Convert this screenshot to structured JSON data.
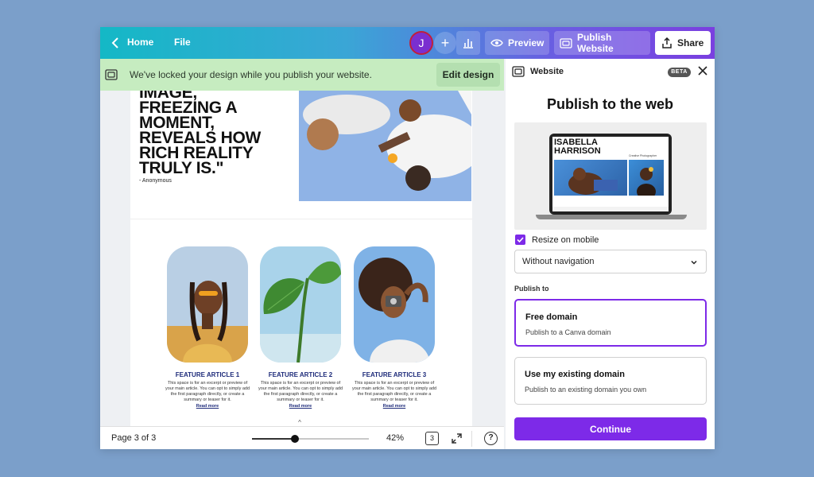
{
  "topbar": {
    "home_label": "Home",
    "file_label": "File",
    "avatar_initial": "J",
    "plus_label": "+",
    "preview_label": "Preview",
    "publish_label": "Publish Website",
    "share_label": "Share"
  },
  "banner": {
    "message": "We've locked your design while you publish your website.",
    "edit_label": "Edit design"
  },
  "canvas": {
    "quote_text": "IMAGE,\nFREEZING A\nMOMENT,\nREVEALS HOW\nRICH REALITY\nTRULY IS.\"",
    "quote_author": "- Anonymous",
    "cards": [
      {
        "title": "FEATURE ARTICLE 1",
        "desc": "This space is for an excerpt or preview of your main article. You can opt to simply add the first paragraph directly, or create a summary or teaser for it.",
        "link": "Read more"
      },
      {
        "title": "FEATURE ARTICLE 2",
        "desc": "This space is for an excerpt or preview of your main article. You can opt to simply add the first paragraph directly, or create a summary or teaser for it.",
        "link": "Read more"
      },
      {
        "title": "FEATURE ARTICLE 3",
        "desc": "This space is for an excerpt or preview of your main article. You can opt to simply add the first paragraph directly, or create a summary or teaser for it.",
        "link": "Read more"
      }
    ],
    "collapse_glyph": "^"
  },
  "bottombar": {
    "page_label": "Page 3 of 3",
    "zoom_level": 0.37,
    "zoom_label": "42%",
    "pages_count": "3",
    "help_label": "?"
  },
  "panel": {
    "title": "Website",
    "beta_label": "BETA",
    "heading": "Publish to the web",
    "preview_name": "ISABELLA\nHARRISON",
    "preview_sub": "Creative Photographer",
    "resize_label": "Resize on mobile",
    "resize_checked": true,
    "navigation_value": "Without navigation",
    "publish_to_label": "Publish to",
    "options": [
      {
        "title": "Free domain",
        "sub": "Publish to a Canva domain"
      },
      {
        "title": "Use my existing domain",
        "sub": "Publish to an existing domain you own"
      }
    ],
    "continue_label": "Continue"
  },
  "colors": {
    "accent": "#7d2ae8",
    "banner": "#c6ecc0",
    "link": "#1e2b7a"
  }
}
